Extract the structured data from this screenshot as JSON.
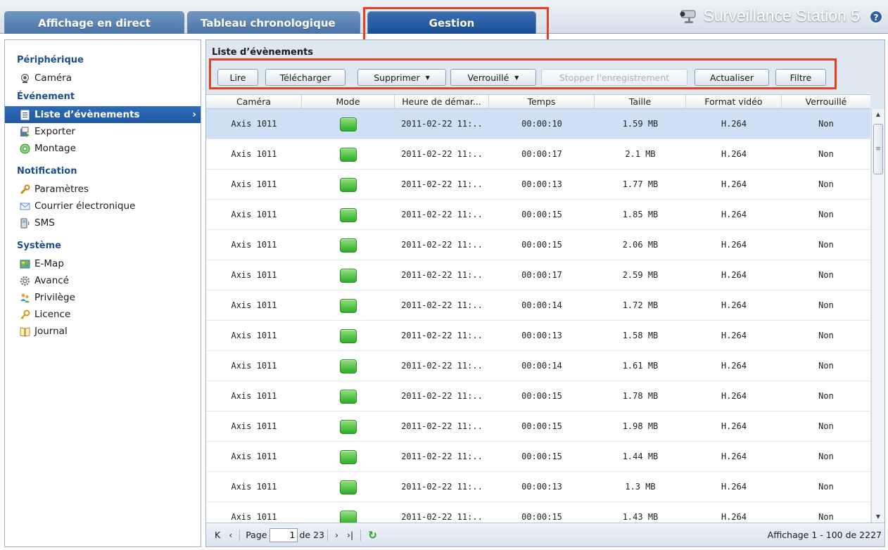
{
  "tabs": {
    "live": "Affichage en direct",
    "timeline": "Tableau chronologique",
    "management": "Gestion"
  },
  "brand": {
    "title": "Surveillance Station 5",
    "help": "?"
  },
  "sidebar": {
    "sections": [
      {
        "title": "Périphérique",
        "items": [
          {
            "label": "Caméra",
            "icon": "camera-icon"
          }
        ]
      },
      {
        "title": "Événement",
        "items": [
          {
            "label": "Liste d’évènements",
            "icon": "list-icon",
            "selected": true
          },
          {
            "label": "Exporter",
            "icon": "export-icon"
          },
          {
            "label": "Montage",
            "icon": "montage-icon"
          }
        ]
      },
      {
        "title": "Notification",
        "items": [
          {
            "label": "Paramètres",
            "icon": "wrench-icon"
          },
          {
            "label": "Courrier électronique",
            "icon": "mail-icon"
          },
          {
            "label": "SMS",
            "icon": "sms-icon"
          }
        ]
      },
      {
        "title": "Système",
        "items": [
          {
            "label": "E-Map",
            "icon": "map-icon"
          },
          {
            "label": "Avancé",
            "icon": "gear-icon"
          },
          {
            "label": "Privilège",
            "icon": "users-icon"
          },
          {
            "label": "Licence",
            "icon": "key-icon"
          },
          {
            "label": "Journal",
            "icon": "book-icon"
          }
        ]
      }
    ]
  },
  "panel": {
    "title": "Liste d’évènements"
  },
  "toolbar": {
    "play": "Lire",
    "download": "Télécharger",
    "delete": "Supprimer",
    "locked": "Verrouillé",
    "stop_recording": "Stopper l'enregistrement",
    "refresh": "Actualiser",
    "filter": "Filtre"
  },
  "table": {
    "columns": [
      "Caméra",
      "Mode",
      "Heure de démar...",
      "Temps",
      "Taille",
      "Format vidéo",
      "Verrouillé"
    ],
    "rows": [
      {
        "camera": "Axis 1011",
        "start": "2011-02-22 11:..",
        "duration": "00:00:10",
        "size": "1.59 MB",
        "format": "H.264",
        "locked": "Non"
      },
      {
        "camera": "Axis 1011",
        "start": "2011-02-22 11:..",
        "duration": "00:00:17",
        "size": "2.1 MB",
        "format": "H.264",
        "locked": "Non"
      },
      {
        "camera": "Axis 1011",
        "start": "2011-02-22 11:..",
        "duration": "00:00:13",
        "size": "1.77 MB",
        "format": "H.264",
        "locked": "Non"
      },
      {
        "camera": "Axis 1011",
        "start": "2011-02-22 11:..",
        "duration": "00:00:15",
        "size": "1.85 MB",
        "format": "H.264",
        "locked": "Non"
      },
      {
        "camera": "Axis 1011",
        "start": "2011-02-22 11:..",
        "duration": "00:00:15",
        "size": "2.06 MB",
        "format": "H.264",
        "locked": "Non"
      },
      {
        "camera": "Axis 1011",
        "start": "2011-02-22 11:..",
        "duration": "00:00:17",
        "size": "2.59 MB",
        "format": "H.264",
        "locked": "Non"
      },
      {
        "camera": "Axis 1011",
        "start": "2011-02-22 11:..",
        "duration": "00:00:14",
        "size": "1.72 MB",
        "format": "H.264",
        "locked": "Non"
      },
      {
        "camera": "Axis 1011",
        "start": "2011-02-22 11:..",
        "duration": "00:00:13",
        "size": "1.58 MB",
        "format": "H.264",
        "locked": "Non"
      },
      {
        "camera": "Axis 1011",
        "start": "2011-02-22 11:..",
        "duration": "00:00:14",
        "size": "1.61 MB",
        "format": "H.264",
        "locked": "Non"
      },
      {
        "camera": "Axis 1011",
        "start": "2011-02-22 11:..",
        "duration": "00:00:15",
        "size": "1.78 MB",
        "format": "H.264",
        "locked": "Non"
      },
      {
        "camera": "Axis 1011",
        "start": "2011-02-22 11:..",
        "duration": "00:00:15",
        "size": "1.98 MB",
        "format": "H.264",
        "locked": "Non"
      },
      {
        "camera": "Axis 1011",
        "start": "2011-02-22 11:..",
        "duration": "00:00:15",
        "size": "1.44 MB",
        "format": "H.264",
        "locked": "Non"
      },
      {
        "camera": "Axis 1011",
        "start": "2011-02-22 11:..",
        "duration": "00:00:13",
        "size": "1.3 MB",
        "format": "H.264",
        "locked": "Non"
      },
      {
        "camera": "Axis 1011",
        "start": "2011-02-22 11:..",
        "duration": "00:00:15",
        "size": "1.43 MB",
        "format": "H.264",
        "locked": "Non"
      }
    ]
  },
  "pager": {
    "page_label": "Page",
    "current_page": "1",
    "of_total": "de 23",
    "status": "Affichage 1 - 100 de 2227"
  },
  "colors": {
    "accent": "#1e58a2",
    "highlight": "#e8401c",
    "selected_row": "#cfe0f5",
    "mode_green": "#2fae2a"
  }
}
